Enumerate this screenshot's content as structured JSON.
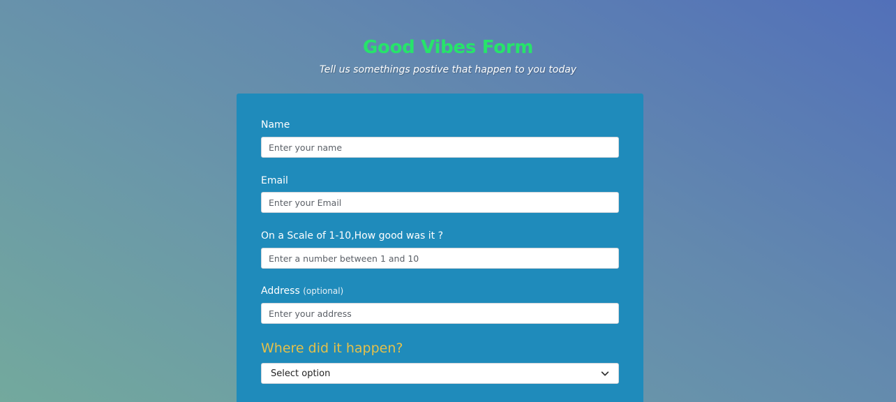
{
  "header": {
    "title": "Good Vibes Form",
    "subtitle": "Tell us somethings postive that happen to you today"
  },
  "form": {
    "name": {
      "label": "Name",
      "placeholder": "Enter your name"
    },
    "email": {
      "label": "Email",
      "placeholder": "Enter your Email"
    },
    "scale": {
      "label": "On a Scale of 1-10,How good was it ?",
      "placeholder": "Enter a number between 1 and 10"
    },
    "address": {
      "label": "Address",
      "optional_note": "(optional)",
      "placeholder": "Enter your address"
    },
    "location": {
      "question": "Where did it happen?",
      "selected": "Select option"
    }
  },
  "colors": {
    "title": "#27e36b",
    "card": "#1f8bbb",
    "question": "#e4c04a"
  },
  "icons": {
    "select_arrow": "chevron-down-icon"
  }
}
